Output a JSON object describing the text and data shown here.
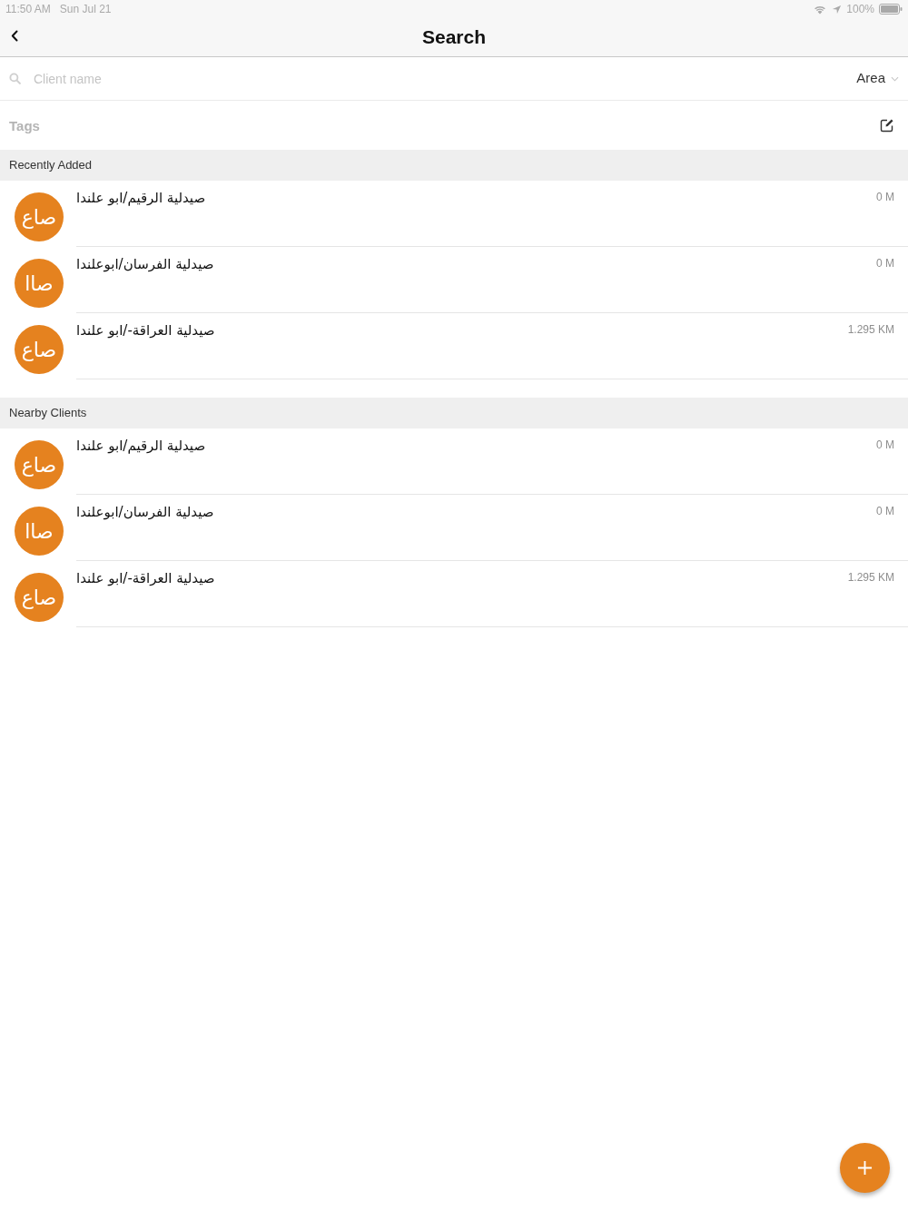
{
  "status_bar": {
    "time": "11:50 AM",
    "date": "Sun Jul 21",
    "battery": "100%"
  },
  "nav_bar": {
    "title": "Search"
  },
  "search": {
    "placeholder": "Client name",
    "area": "Area"
  },
  "tags": {
    "placeholder": "Tags"
  },
  "sections": [
    {
      "title": "Recently Added",
      "clients": [
        {
          "initials": "صاع",
          "name": "صيدلية الرقيم/ابو علندا",
          "distance": "0 M"
        },
        {
          "initials": "صاا",
          "name": "صيدلية الفرسان/ابوعلندا",
          "distance": "0 M"
        },
        {
          "initials": "صاع",
          "name": "صيدلية العراقة-/ابو علندا",
          "distance": "1.295 KM"
        }
      ]
    },
    {
      "title": "Nearby Clients",
      "clients": [
        {
          "initials": "صاع",
          "name": "صيدلية الرقيم/ابو علندا",
          "distance": "0 M"
        },
        {
          "initials": "صاا",
          "name": "صيدلية الفرسان/ابوعلندا",
          "distance": "0 M"
        },
        {
          "initials": "صاع",
          "name": "صيدلية العراقة-/ابو علندا",
          "distance": "1.295 KM"
        }
      ]
    }
  ]
}
